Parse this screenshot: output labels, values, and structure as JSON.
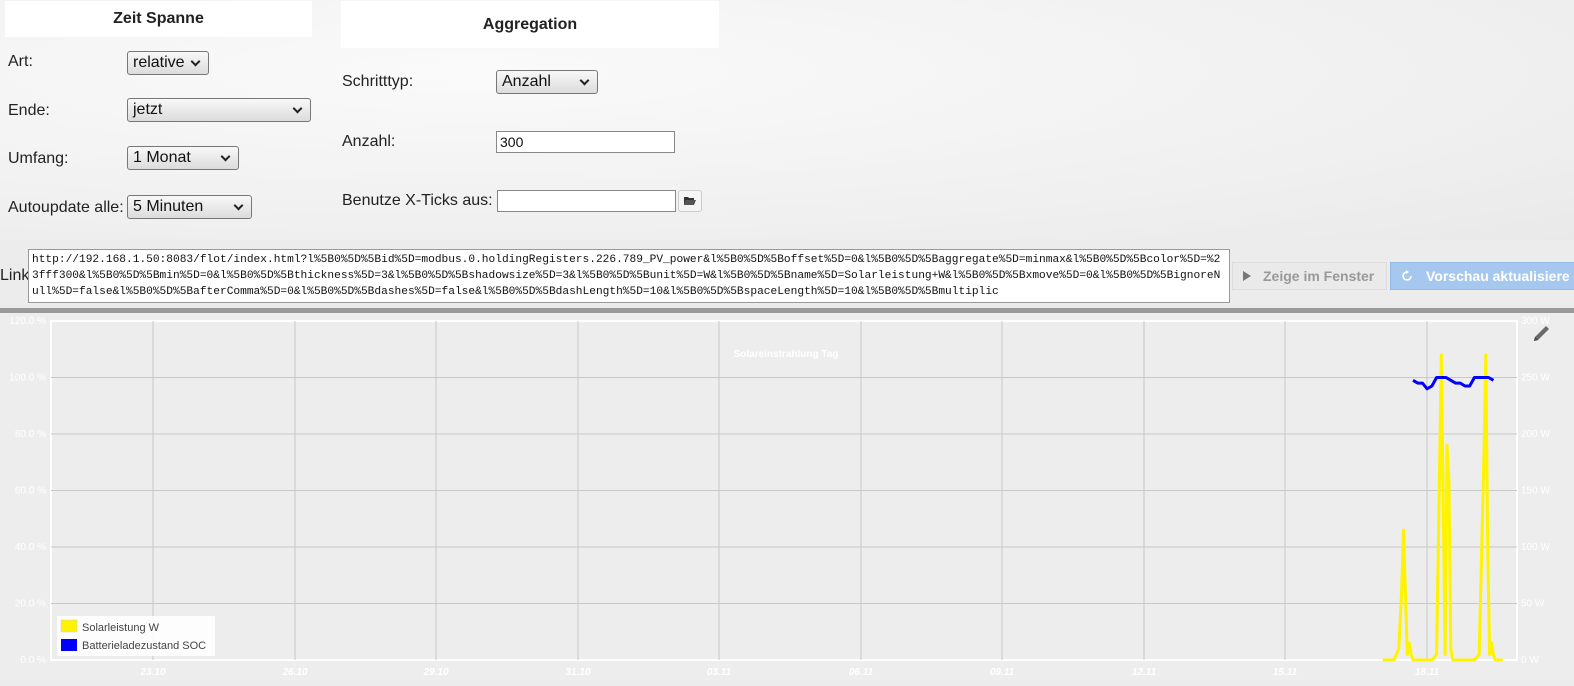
{
  "time_panel": {
    "title": "Zeit Spanne",
    "art_label": "Art:",
    "art_value": "relative",
    "ende_label": "Ende:",
    "ende_value": "jetzt",
    "umfang_label": "Umfang:",
    "umfang_value": "1 Monat",
    "autoupdate_label": "Autoupdate alle:",
    "autoupdate_value": "5 Minuten"
  },
  "aggregation_panel": {
    "title": "Aggregation",
    "schritttyp_label": "Schritttyp:",
    "schritttyp_value": "Anzahl",
    "anzahl_label": "Anzahl:",
    "anzahl_value": "300",
    "xticks_label": "Benutze X-Ticks aus:",
    "xticks_value": ""
  },
  "link": {
    "label": "Link",
    "url": "http://192.168.1.50:8083/flot/index.html?l%5B0%5D%5Bid%5D=modbus.0.holdingRegisters.226.789_PV_power&l%5B0%5D%5Boffset%5D=0&l%5B0%5D%5Baggregate%5D=minmax&l%5B0%5D%5Bcolor%5D=%23fff300&l%5B0%5D%5Bmin%5D=0&l%5B0%5D%5Bthickness%5D=3&l%5B0%5D%5Bshadowsize%5D=3&l%5B0%5D%5Bunit%5D=W&l%5B0%5D%5Bname%5D=Solarleistung+W&l%5B0%5D%5Bxmove%5D=0&l%5B0%5D%5BignoreNull%5D=false&l%5B0%5D%5BafterComma%5D=0&l%5B0%5D%5Bdashes%5D=false&l%5B0%5D%5BdashLength%5D=10&l%5B0%5D%5BspaceLength%5D=10&l%5B0%5D%5Bmultiplic",
    "show_window_label": "Zeige im Fenster",
    "refresh_preview_label": "Vorschau aktualisiere"
  },
  "chart_data": {
    "type": "line",
    "title": "Solareinstrahlung Tag",
    "x_ticks": [
      "23.10",
      "26.10",
      "29.10",
      "31.10",
      "03.11",
      "06.11",
      "09.11",
      "12.11",
      "15.11",
      "18.11"
    ],
    "y_left_ticks": [
      "0.0 %",
      "20.0 %",
      "40.0 %",
      "60.0 %",
      "80.0 %",
      "100.0 %",
      "120.0 %"
    ],
    "y_right_ticks": [
      "0 W",
      "50 W",
      "100 W",
      "150 W",
      "200 W",
      "250 W",
      "300 W"
    ],
    "y_left_range": [
      0,
      120
    ],
    "y_right_range": [
      0,
      300
    ],
    "x_range_days": [
      0,
      31.0
    ],
    "grid": true,
    "legend_position": "bottom-left",
    "series": [
      {
        "name": "Solarleistung W",
        "color": "#fff300",
        "axis": "right",
        "points": [
          [
            28.16,
            0
          ],
          [
            28.4,
            0
          ],
          [
            28.5,
            10
          ],
          [
            28.56,
            60
          ],
          [
            28.6,
            115
          ],
          [
            28.64,
            60
          ],
          [
            28.68,
            5
          ],
          [
            28.72,
            15
          ],
          [
            28.76,
            5
          ],
          [
            28.8,
            0
          ],
          [
            29.2,
            0
          ],
          [
            29.3,
            5
          ],
          [
            29.36,
            160
          ],
          [
            29.4,
            270
          ],
          [
            29.44,
            140
          ],
          [
            29.48,
            5
          ],
          [
            29.52,
            190
          ],
          [
            29.56,
            160
          ],
          [
            29.6,
            10
          ],
          [
            29.64,
            0
          ],
          [
            30.1,
            0
          ],
          [
            30.2,
            5
          ],
          [
            30.26,
            110
          ],
          [
            30.3,
            180
          ],
          [
            30.34,
            270
          ],
          [
            30.38,
            100
          ],
          [
            30.42,
            5
          ],
          [
            30.46,
            15
          ],
          [
            30.5,
            5
          ],
          [
            30.54,
            0
          ],
          [
            30.7,
            0
          ]
        ]
      },
      {
        "name": "Batterieladezustand SOC",
        "color": "#0000ff",
        "axis": "left",
        "points": [
          [
            28.8,
            99
          ],
          [
            28.9,
            98
          ],
          [
            29.0,
            98
          ],
          [
            29.1,
            96
          ],
          [
            29.2,
            97
          ],
          [
            29.3,
            100
          ],
          [
            29.5,
            100
          ],
          [
            29.6,
            99
          ],
          [
            29.7,
            98
          ],
          [
            29.8,
            98
          ],
          [
            29.9,
            97
          ],
          [
            30.0,
            97
          ],
          [
            30.1,
            100
          ],
          [
            30.4,
            100
          ],
          [
            30.5,
            99
          ]
        ]
      }
    ]
  },
  "colors": {
    "refresh_button": "#a6c8ee",
    "solar": "#fff300",
    "soc": "#0000ff"
  },
  "icons": [
    "folder-open-icon",
    "play-triangle-icon",
    "refresh-icon",
    "pencil-icon"
  ]
}
